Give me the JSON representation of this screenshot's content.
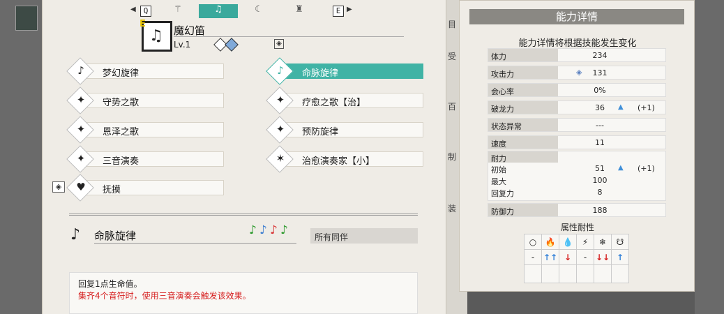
{
  "tabs": {
    "left_key": "Q",
    "right_key": "E",
    "left_arrow": "◀",
    "right_arrow": "▶",
    "items": [
      {
        "icon": "⚚"
      },
      {
        "icon": "♫"
      },
      {
        "icon": "☾"
      },
      {
        "icon": "♜"
      }
    ]
  },
  "weapon": {
    "equip_tag": "E",
    "glyph": "♫",
    "name": "魔幻笛",
    "level": "Lv.1",
    "deco_glyph": "◈"
  },
  "skills": [
    {
      "label": "梦幻旋律",
      "icon": "♪",
      "selected": false
    },
    {
      "label": "命脉旋律",
      "icon": "♪",
      "selected": true
    },
    {
      "label": "守势之歌",
      "icon": "✦",
      "selected": false
    },
    {
      "label": "疗愈之歌【治】",
      "icon": "✦",
      "selected": false
    },
    {
      "label": "恩泽之歌",
      "icon": "✦",
      "selected": false
    },
    {
      "label": "预防旋律",
      "icon": "✦",
      "selected": false
    },
    {
      "label": "三音演奏",
      "icon": "✦",
      "selected": false
    },
    {
      "label": "治愈演奏家【小】",
      "icon": "✶",
      "selected": false
    },
    {
      "label": "抚摸",
      "icon": "♥",
      "selected": false
    }
  ],
  "lock_glyph": "◈",
  "detail": {
    "icon": "♪",
    "name": "命脉旋律",
    "notes": [
      "♪",
      "♪",
      "♪",
      "♪"
    ],
    "note_colors": [
      "#2e9a2e",
      "#3f7fd0",
      "#d83a3a",
      "#2e9a2e"
    ],
    "target": "所有同伴",
    "desc1": "回复1点生命值。",
    "desc2": "集齐4个音符时，使用三音演奏会触发该效果。"
  },
  "side_fragments": [
    "目",
    "受",
    "百",
    "制",
    "装"
  ],
  "right": {
    "header": "能力详情",
    "subtitle": "能力详情将根据技能发生变化",
    "stats": [
      {
        "label": "体力",
        "value": "234"
      },
      {
        "label": "攻击力",
        "value": "131",
        "gem": "◈"
      },
      {
        "label": "会心率",
        "value": "0%"
      },
      {
        "label": "破龙力",
        "value": "36",
        "up": "▲",
        "delta": "(+1)"
      },
      {
        "label": "状态异常",
        "value": "---"
      },
      {
        "label": "速度",
        "value": "11"
      }
    ],
    "stamina": {
      "label": "耐力",
      "rows": [
        {
          "name": "初始",
          "value": "51",
          "up": "▲",
          "delta": "(+1)"
        },
        {
          "name": "最大",
          "value": "100"
        },
        {
          "name": "回复力",
          "value": "8"
        }
      ]
    },
    "defense": {
      "label": "防御力",
      "value": "188"
    },
    "resist_title": "属性耐性",
    "resist_icons": [
      "○",
      "🔥",
      "💧",
      "⚡",
      "❄",
      "☋"
    ],
    "resist_values": [
      "-",
      "↑↑",
      "↓",
      "-",
      "↓↓",
      "↑"
    ]
  }
}
